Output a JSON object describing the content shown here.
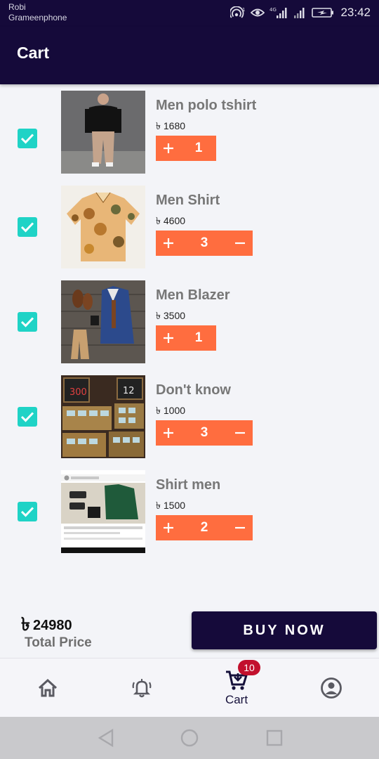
{
  "status_bar": {
    "carrier_1": "Robi",
    "carrier_2": "Grameenphone",
    "time": "23:42"
  },
  "app_bar": {
    "title": "Cart"
  },
  "currency_symbol": "৳",
  "cart": {
    "items": [
      {
        "name": "Men polo tshirt",
        "price": "1680",
        "quantity": "1",
        "checked": true,
        "image": "man in black sweater and khaki pants"
      },
      {
        "name": "Men Shirt",
        "price": "4600",
        "quantity": "3",
        "checked": true,
        "image": "floral camp collar shirt"
      },
      {
        "name": "Men Blazer",
        "price": "3500",
        "quantity": "1",
        "checked": true,
        "image": "blue blazer outfit flat lay"
      },
      {
        "name": "Don't know",
        "price": "1000",
        "quantity": "3",
        "checked": true,
        "image": "market baskets with price boards"
      },
      {
        "name": "Shirt men",
        "price": "1500",
        "quantity": "2",
        "checked": true,
        "image": "green shirt and shoes screenshot"
      }
    ]
  },
  "summary": {
    "total_symbol": "৳",
    "total_amount": "24980",
    "total_label": "Total Price",
    "buy_label": "BUY NOW"
  },
  "bottom_nav": {
    "cart_label": "Cart",
    "cart_badge": "10"
  },
  "colors": {
    "primary": "#150a3a",
    "accent": "#ff6d3f",
    "checkbox": "#1fd3c6",
    "badge": "#c2102d"
  }
}
